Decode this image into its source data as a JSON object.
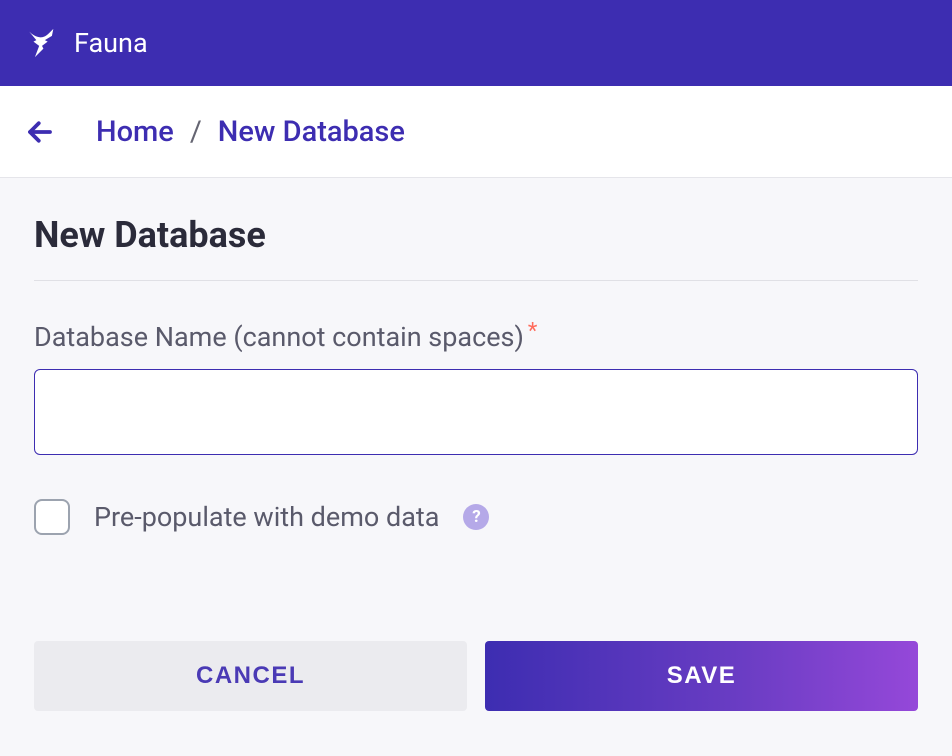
{
  "header": {
    "brand": "Fauna"
  },
  "breadcrumb": {
    "home": "Home",
    "separator": "/",
    "current": "New Database"
  },
  "page": {
    "title": "New Database"
  },
  "form": {
    "database_name_label": "Database Name (cannot contain spaces)",
    "database_name_value": "",
    "demo_data_label": "Pre-populate with demo data",
    "demo_data_checked": false
  },
  "actions": {
    "cancel": "CANCEL",
    "save": "SAVE"
  }
}
